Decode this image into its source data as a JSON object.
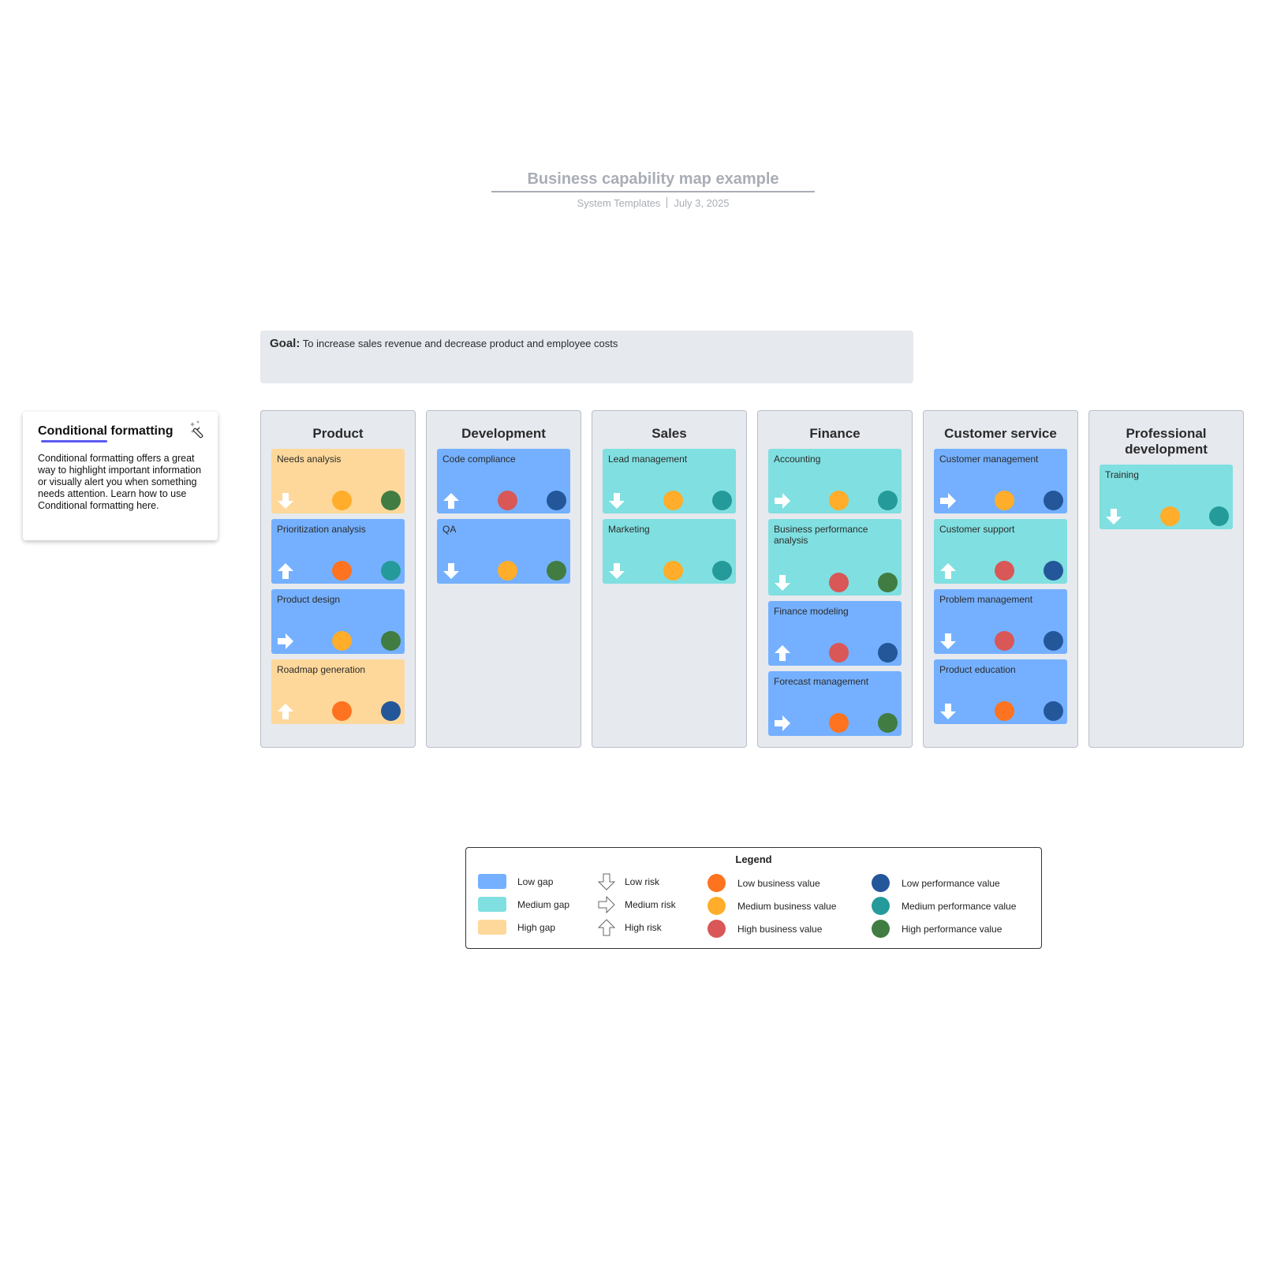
{
  "header": {
    "title": "Business capability map example",
    "author": "System Templates",
    "date": "July 3, 2025"
  },
  "conditional_formatting": {
    "title": "Conditional formatting",
    "body": "Conditional formatting offers a great way to highlight important information or visually alert you when something needs attention. Learn how to use Conditional formatting here.",
    "icon": "magic-wand-icon"
  },
  "goal": {
    "label": "Goal:",
    "text": "To increase sales revenue and decrease product and employee costs"
  },
  "colors": {
    "gap": {
      "low": "#74b0ff",
      "medium": "#80dfe0",
      "high": "#fed89a"
    },
    "business_value": {
      "low": "#fe7320",
      "medium": "#ffad2a",
      "high": "#d95757"
    },
    "performance_value": {
      "low": "#235799",
      "medium": "#259a9a",
      "high": "#417c42"
    },
    "arrow": "#ffffff"
  },
  "columns": [
    {
      "title": "Product",
      "capabilities": [
        {
          "name": "Needs analysis",
          "gap": "high",
          "risk": "low",
          "business_value": "medium",
          "performance_value": "high"
        },
        {
          "name": "Prioritization analysis",
          "gap": "low",
          "risk": "high",
          "business_value": "low",
          "performance_value": "medium"
        },
        {
          "name": "Product design",
          "gap": "low",
          "risk": "medium",
          "business_value": "medium",
          "performance_value": "high"
        },
        {
          "name": "Roadmap generation",
          "gap": "high",
          "risk": "high",
          "business_value": "low",
          "performance_value": "low"
        }
      ]
    },
    {
      "title": "Development",
      "capabilities": [
        {
          "name": "Code compliance",
          "gap": "low",
          "risk": "high",
          "business_value": "high",
          "performance_value": "low"
        },
        {
          "name": "QA",
          "gap": "low",
          "risk": "low",
          "business_value": "medium",
          "performance_value": "high"
        }
      ]
    },
    {
      "title": "Sales",
      "capabilities": [
        {
          "name": "Lead management",
          "gap": "medium",
          "risk": "low",
          "business_value": "medium",
          "performance_value": "medium"
        },
        {
          "name": "Marketing",
          "gap": "medium",
          "risk": "low",
          "business_value": "medium",
          "performance_value": "medium"
        }
      ]
    },
    {
      "title": "Finance",
      "capabilities": [
        {
          "name": "Accounting",
          "gap": "medium",
          "risk": "medium",
          "business_value": "medium",
          "performance_value": "medium"
        },
        {
          "name": "Business performance analysis",
          "gap": "medium",
          "risk": "low",
          "business_value": "high",
          "performance_value": "high",
          "tall": true
        },
        {
          "name": "Finance modeling",
          "gap": "low",
          "risk": "high",
          "business_value": "high",
          "performance_value": "low"
        },
        {
          "name": "Forecast management",
          "gap": "low",
          "risk": "medium",
          "business_value": "low",
          "performance_value": "high"
        }
      ]
    },
    {
      "title": "Customer service",
      "capabilities": [
        {
          "name": "Customer management",
          "gap": "low",
          "risk": "medium",
          "business_value": "medium",
          "performance_value": "low"
        },
        {
          "name": "Customer support",
          "gap": "medium",
          "risk": "high",
          "business_value": "high",
          "performance_value": "low"
        },
        {
          "name": "Problem management",
          "gap": "low",
          "risk": "low",
          "business_value": "high",
          "performance_value": "low"
        },
        {
          "name": "Product education",
          "gap": "low",
          "risk": "low",
          "business_value": "low",
          "performance_value": "low"
        }
      ]
    },
    {
      "title": "Professional development",
      "capabilities": [
        {
          "name": "Training",
          "gap": "medium",
          "risk": "low",
          "business_value": "medium",
          "performance_value": "medium"
        }
      ]
    }
  ],
  "legend": {
    "title": "Legend",
    "gap": [
      {
        "label": "Low gap",
        "level": "low"
      },
      {
        "label": "Medium gap",
        "level": "medium"
      },
      {
        "label": "High gap",
        "level": "high"
      }
    ],
    "risk": [
      {
        "label": "Low risk",
        "level": "low",
        "icon": "arrow-down-icon"
      },
      {
        "label": "Medium risk",
        "level": "medium",
        "icon": "arrow-right-icon"
      },
      {
        "label": "High risk",
        "level": "high",
        "icon": "arrow-up-icon"
      }
    ],
    "business_value": [
      {
        "label": "Low business value",
        "level": "low"
      },
      {
        "label": "Medium business value",
        "level": "medium"
      },
      {
        "label": "High business value",
        "level": "high"
      }
    ],
    "performance_value": [
      {
        "label": "Low performance value",
        "level": "low"
      },
      {
        "label": "Medium performance value",
        "level": "medium"
      },
      {
        "label": "High performance value",
        "level": "high"
      }
    ]
  }
}
